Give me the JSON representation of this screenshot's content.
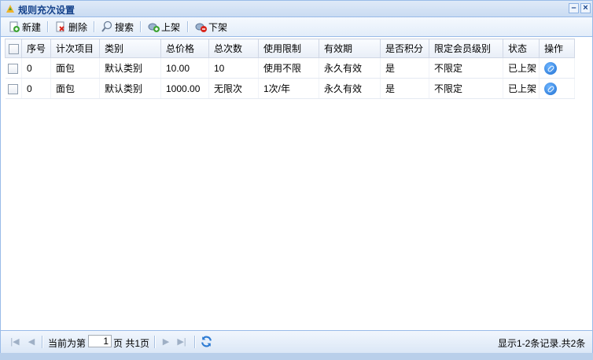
{
  "window": {
    "title": "规则充次设置"
  },
  "toolbar": {
    "new_label": "新建",
    "delete_label": "删除",
    "search_label": "搜索",
    "shelve_label": "上架",
    "unshelve_label": "下架"
  },
  "table": {
    "headers": [
      "序号",
      "计次项目",
      "类别",
      "总价格",
      "总次数",
      "使用限制",
      "有效期",
      "是否积分",
      "限定会员级别",
      "状态",
      "操作"
    ],
    "rows": [
      [
        "0",
        "面包",
        "默认类别",
        "10.00",
        "10",
        "使用不限",
        "永久有效",
        "是",
        "不限定",
        "已上架"
      ],
      [
        "0",
        "面包",
        "默认类别",
        "1000.00",
        "无限次",
        "1次/年",
        "永久有效",
        "是",
        "不限定",
        "已上架"
      ]
    ]
  },
  "pager": {
    "current_prefix": "当前为第",
    "page_value": "1",
    "page_suffix": "页 共1页",
    "summary": "显示1-2条记录.共2条"
  }
}
